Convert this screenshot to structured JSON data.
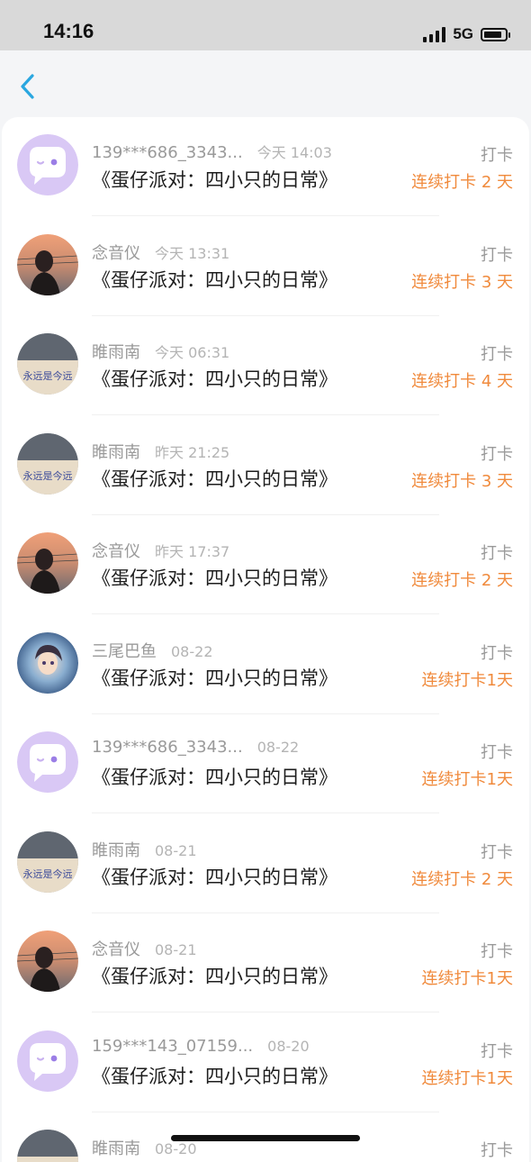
{
  "status_bar": {
    "time": "14:16",
    "network": "5G",
    "battery_level": 0.85
  },
  "nav": {
    "back_icon": "chevron-left-icon"
  },
  "colors": {
    "accent": "#2aa7e0",
    "streak": "#f08a3c",
    "placeholder_avatar_bg": "#d9c8f5"
  },
  "records": [
    {
      "avatar": "placeholder",
      "username": "139***686_3343...",
      "time": "今天 14:03",
      "book": "《蛋仔派对：四小只的日常》",
      "checkin": "打卡",
      "streak": "连续打卡 2 天"
    },
    {
      "avatar": "sunset-girl",
      "username": "念音仪",
      "time": "今天 13:31",
      "book": "《蛋仔派对：四小只的日常》",
      "checkin": "打卡",
      "streak": "连续打卡 3 天"
    },
    {
      "avatar": "note-sky",
      "username": "睢雨南",
      "time": "今天 06:31",
      "book": "《蛋仔派对：四小只的日常》",
      "checkin": "打卡",
      "streak": "连续打卡 4 天"
    },
    {
      "avatar": "note-sky",
      "username": "睢雨南",
      "time": "昨天 21:25",
      "book": "《蛋仔派对：四小只的日常》",
      "checkin": "打卡",
      "streak": "连续打卡 3 天"
    },
    {
      "avatar": "sunset-girl",
      "username": "念音仪",
      "time": "昨天 17:37",
      "book": "《蛋仔派对：四小只的日常》",
      "checkin": "打卡",
      "streak": "连续打卡 2 天"
    },
    {
      "avatar": "anime-girl",
      "username": "三尾巴鱼",
      "time": "08-22",
      "book": "《蛋仔派对：四小只的日常》",
      "checkin": "打卡",
      "streak": "连续打卡1天"
    },
    {
      "avatar": "placeholder",
      "username": "139***686_3343...",
      "time": "08-22",
      "book": "《蛋仔派对：四小只的日常》",
      "checkin": "打卡",
      "streak": "连续打卡1天"
    },
    {
      "avatar": "note-sky",
      "username": "睢雨南",
      "time": "08-21",
      "book": "《蛋仔派对：四小只的日常》",
      "checkin": "打卡",
      "streak": "连续打卡 2 天"
    },
    {
      "avatar": "sunset-girl",
      "username": "念音仪",
      "time": "08-21",
      "book": "《蛋仔派对：四小只的日常》",
      "checkin": "打卡",
      "streak": "连续打卡1天"
    },
    {
      "avatar": "placeholder",
      "username": "159***143_07159...",
      "time": "08-20",
      "book": "《蛋仔派对：四小只的日常》",
      "checkin": "打卡",
      "streak": "连续打卡1天"
    },
    {
      "avatar": "note-sky",
      "username": "睢雨南",
      "time": "08-20",
      "book": "",
      "checkin": "打卡",
      "streak": ""
    }
  ],
  "avatar_note_text": "永远是今远"
}
